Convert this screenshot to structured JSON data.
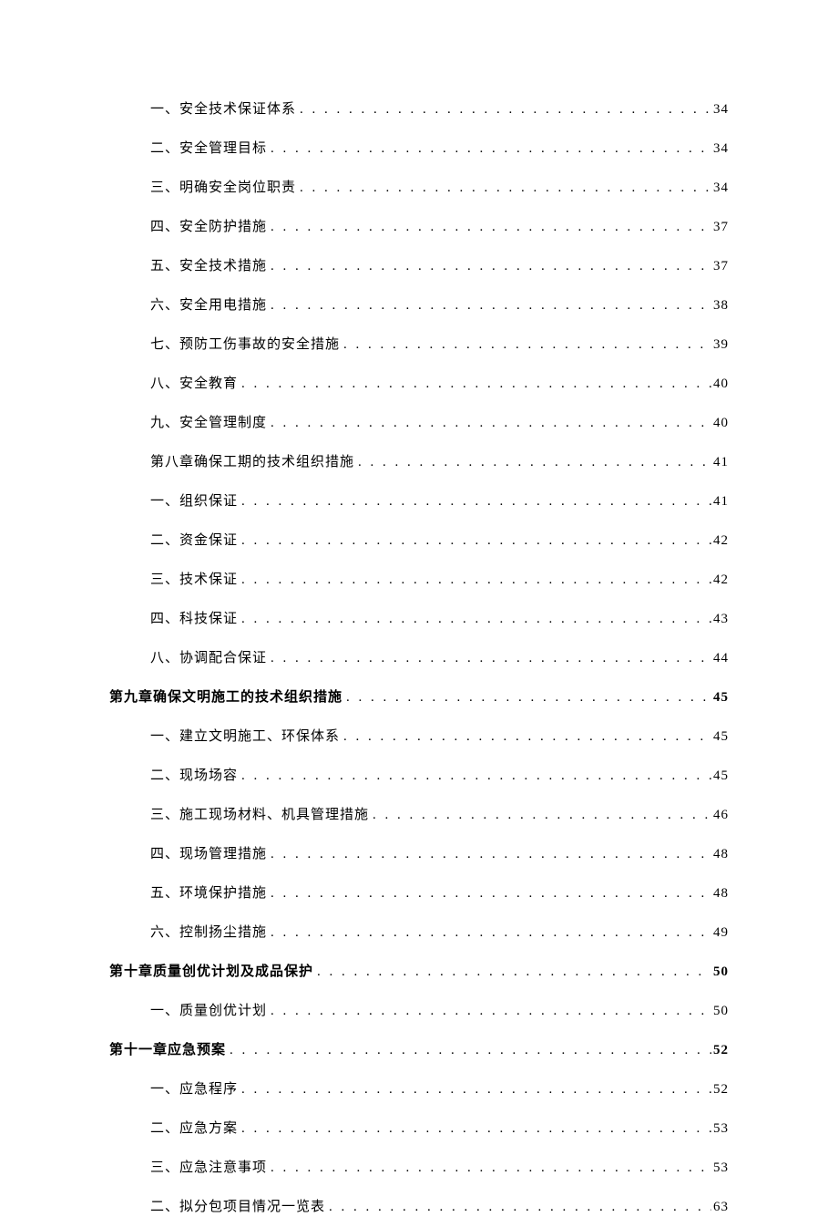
{
  "toc": [
    {
      "label": "一、安全技术保证体系",
      "page": "34",
      "type": "sub"
    },
    {
      "label": "二、安全管理目标",
      "page": "34",
      "type": "sub"
    },
    {
      "label": "三、明确安全岗位职责",
      "page": "34",
      "type": "sub"
    },
    {
      "label": "四、安全防护措施",
      "page": "37",
      "type": "sub"
    },
    {
      "label": "五、安全技术措施",
      "page": "37",
      "type": "sub"
    },
    {
      "label": "六、安全用电措施",
      "page": "38",
      "type": "sub"
    },
    {
      "label": "七、预防工伤事故的安全措施",
      "page": "39",
      "type": "sub"
    },
    {
      "label": "八、安全教育",
      "page": "40",
      "type": "sub"
    },
    {
      "label": "九、安全管理制度",
      "page": "40",
      "type": "sub"
    },
    {
      "label": "第八章确保工期的技术组织措施",
      "page": "41",
      "type": "sub"
    },
    {
      "label": "一、组织保证",
      "page": "41",
      "type": "sub"
    },
    {
      "label": "二、资金保证",
      "page": "42",
      "type": "sub"
    },
    {
      "label": "三、技术保证",
      "page": "42",
      "type": "sub"
    },
    {
      "label": "四、科技保证",
      "page": "43",
      "type": "sub"
    },
    {
      "label": "八、协调配合保证",
      "page": "44",
      "type": "sub"
    },
    {
      "label": "第九章确保文明施工的技术组织措施",
      "page": "45",
      "type": "chapter"
    },
    {
      "label": "一、建立文明施工、环保体系",
      "page": "45",
      "type": "sub"
    },
    {
      "label": "二、现场场容",
      "page": "45",
      "type": "sub"
    },
    {
      "label": "三、施工现场材料、机具管理措施",
      "page": "46",
      "type": "sub"
    },
    {
      "label": "四、现场管理措施",
      "page": "48",
      "type": "sub"
    },
    {
      "label": "五、环境保护措施",
      "page": "48",
      "type": "sub"
    },
    {
      "label": "六、控制扬尘措施",
      "page": "49",
      "type": "sub"
    },
    {
      "label": "第十章质量创优计划及成品保护",
      "page": "50",
      "type": "chapter"
    },
    {
      "label": "一、质量创优计划",
      "page": "50",
      "type": "sub"
    },
    {
      "label": "第十一章应急预案",
      "page": "52",
      "type": "chapter"
    },
    {
      "label": "一、应急程序",
      "page": "52",
      "type": "sub"
    },
    {
      "label": "二、应急方案",
      "page": "53",
      "type": "sub"
    },
    {
      "label": "三、应急注意事项",
      "page": "53",
      "type": "sub"
    },
    {
      "label": "二、拟分包项目情况一览表",
      "page": "63",
      "type": "sub"
    }
  ]
}
